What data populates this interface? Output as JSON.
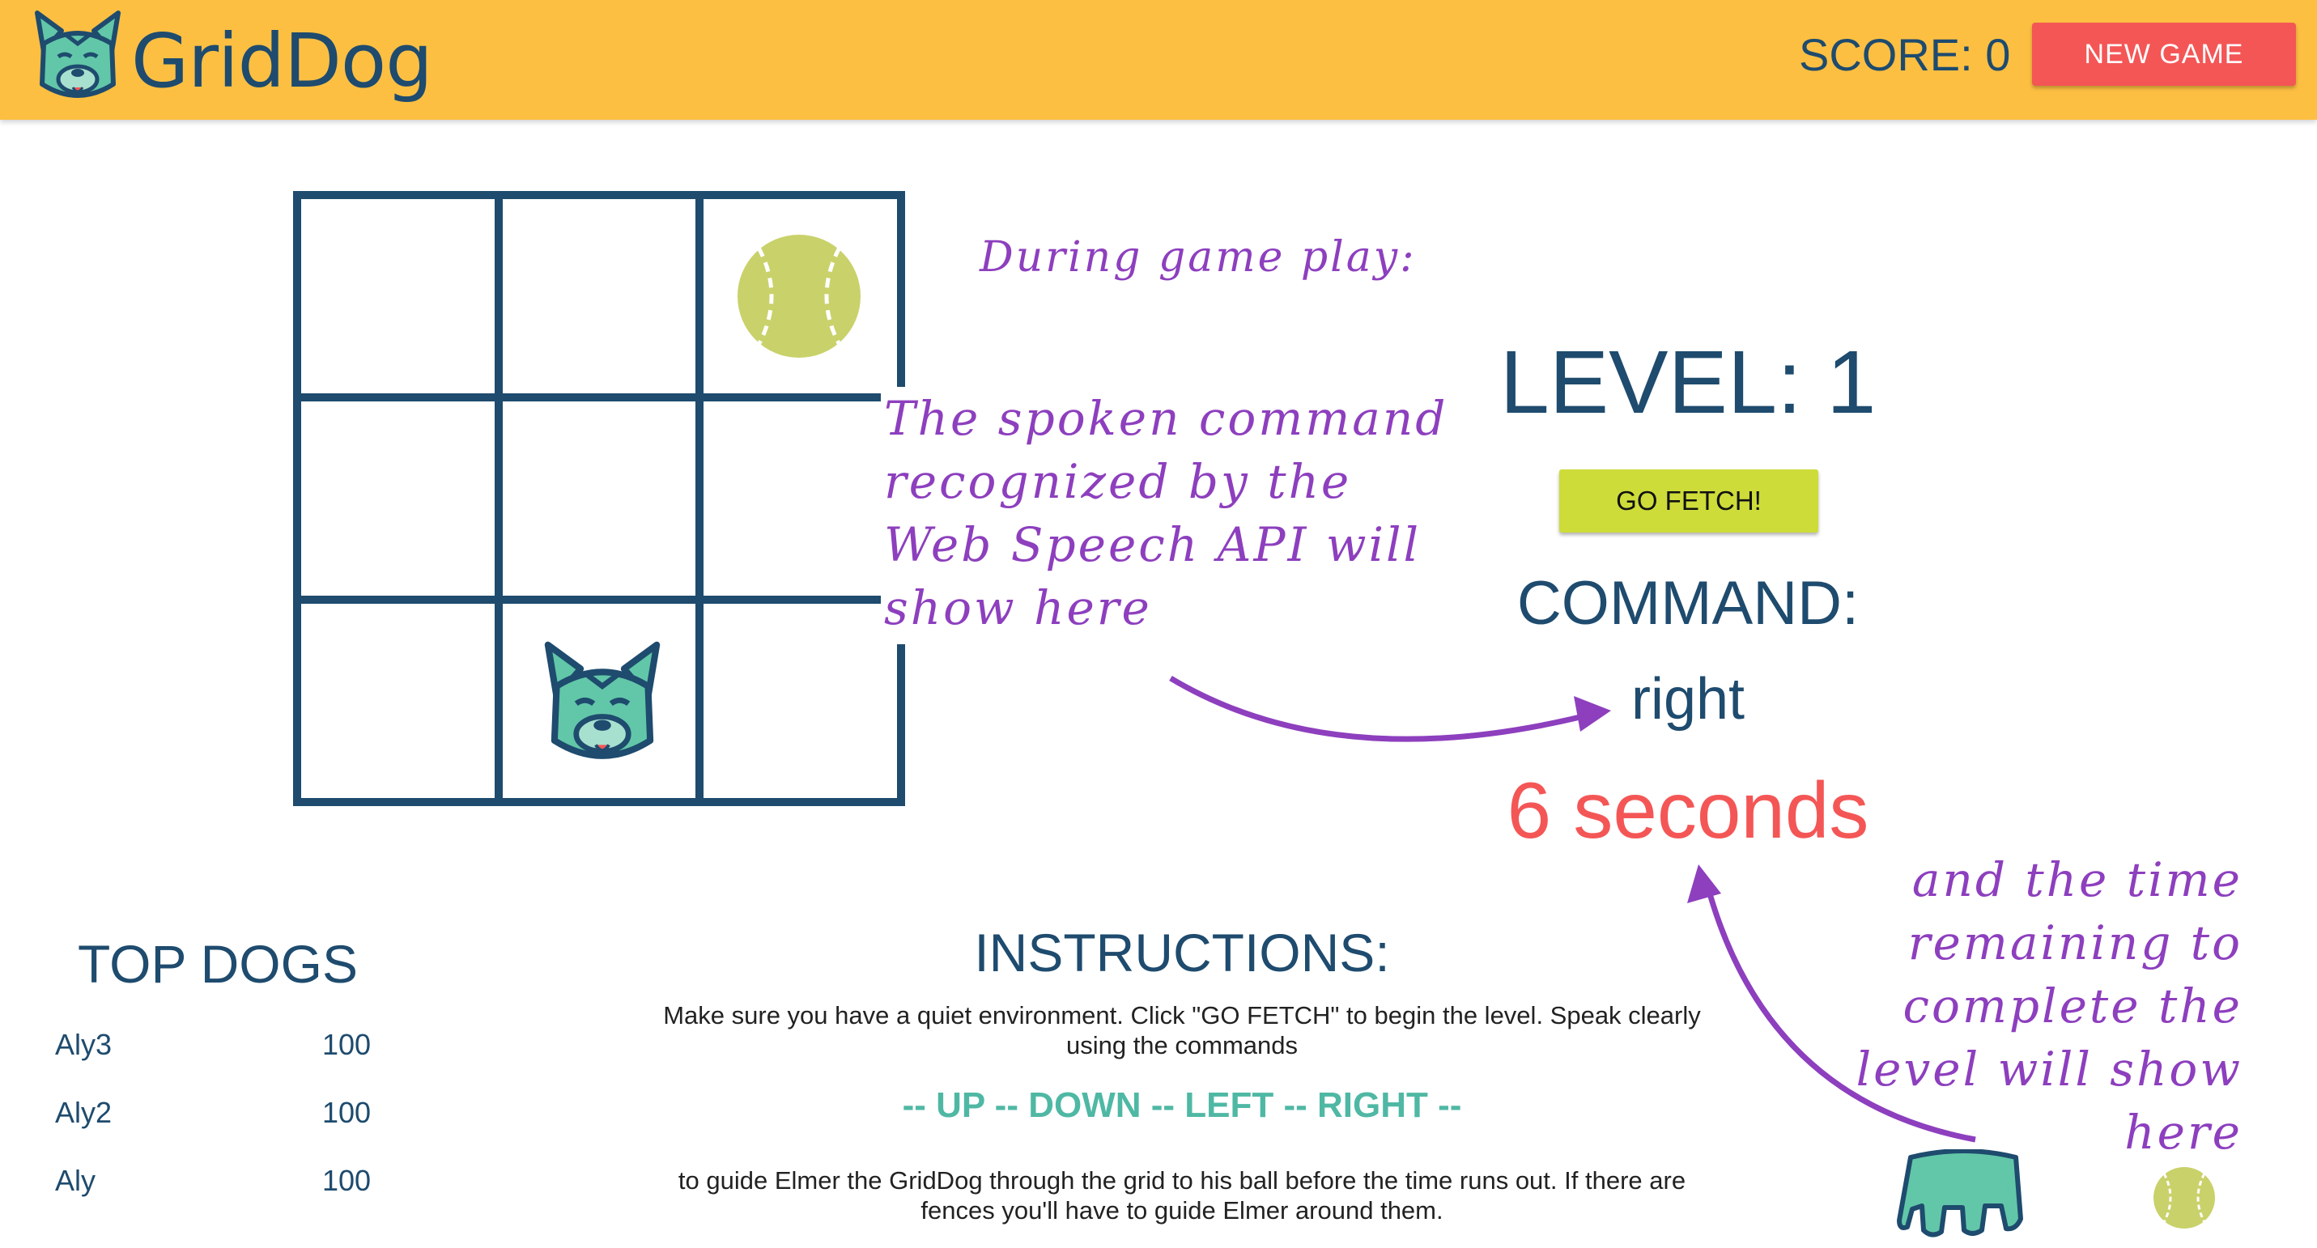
{
  "header": {
    "brand": "GridDog",
    "score_text": "SCORE: 0",
    "new_game_label": "NEW GAME"
  },
  "game": {
    "level_text": "LEVEL: 1",
    "go_fetch_label": "GO FETCH!",
    "command_label": "COMMAND:",
    "command_value": "right",
    "timer_text": "6 seconds",
    "board": {
      "rows": 3,
      "cols": 3,
      "ball_cell": [
        0,
        2
      ],
      "dog_cell": [
        2,
        1
      ]
    }
  },
  "top_dogs": {
    "title": "TOP DOGS",
    "entries": [
      {
        "name": "Aly3",
        "score": "100"
      },
      {
        "name": "Aly2",
        "score": "100"
      },
      {
        "name": "Aly",
        "score": "100"
      }
    ]
  },
  "instructions": {
    "title": "INSTRUCTIONS:",
    "text1": "Make sure you have a quiet environment. Click \"GO FETCH\" to begin the level. Speak clearly using the commands",
    "commands": "-- UP -- DOWN -- LEFT -- RIGHT --",
    "text2": "to guide Elmer the GridDog through the grid to his ball before the time runs out. If there are fences you'll have to guide Elmer around them."
  },
  "annotations": {
    "during": "During game play:",
    "spoken": "The spoken command recognized by the Web Speech API will show here",
    "time": "and the time remaining to complete the level will show here"
  },
  "colors": {
    "header_bg": "#fcbf42",
    "navy": "#1e4b6e",
    "new_game_red": "#f45656",
    "go_fetch_lime": "#cddc39",
    "commands_teal": "#4fb8a4",
    "annotation_purple": "#8d3fbe",
    "ball_green": "#c9d16a"
  },
  "icons": {
    "logo": "dog-face-icon",
    "ball": "tennis-ball-icon",
    "dog": "dog-face-icon"
  }
}
